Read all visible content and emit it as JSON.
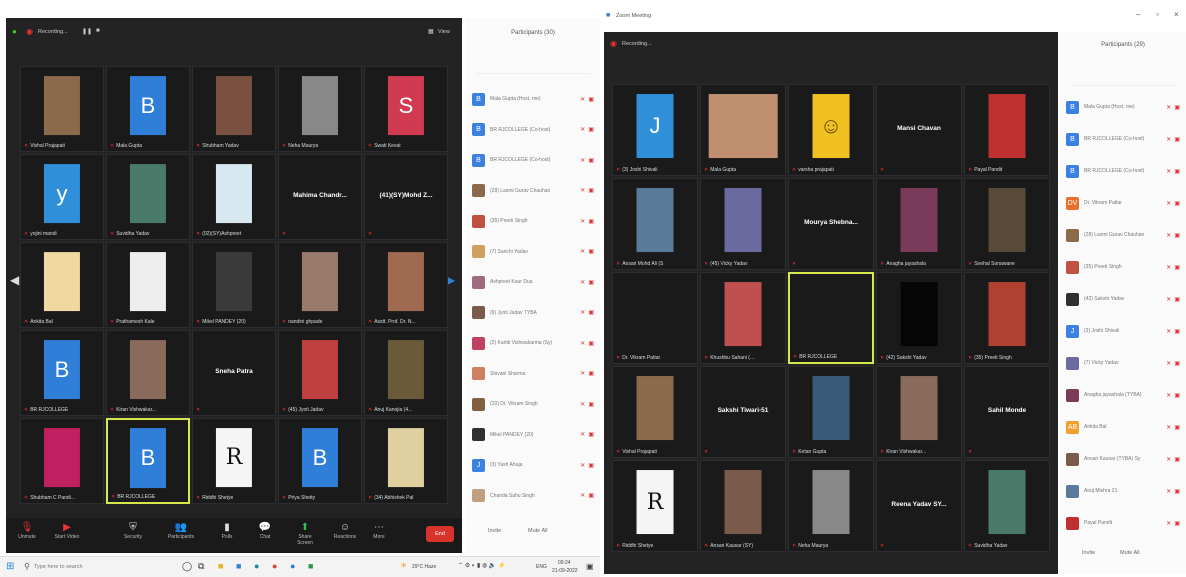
{
  "left": {
    "recording": "Recording...",
    "view": "View",
    "participants_title": "Participants (30)",
    "tiles": [
      {
        "label": "Vishal Prajapati",
        "type": "photo",
        "color": "#8a6a4a"
      },
      {
        "label": "Mala Gupta",
        "type": "letter",
        "letter": "B",
        "color": "#2f7fd8"
      },
      {
        "label": "Shubham Yadav",
        "type": "photo",
        "color": "#7a5040"
      },
      {
        "label": "Neha Maurya",
        "type": "photo",
        "color": "#888"
      },
      {
        "label": "Swati Kevat",
        "type": "letter",
        "letter": "S",
        "color": "#d13b52"
      },
      {
        "label": "yojini mandi",
        "type": "letter",
        "letter": "y",
        "color": "#2f8fd8"
      },
      {
        "label": "Suvidha Yadav",
        "type": "photo",
        "color": "#4a7a6a"
      },
      {
        "label": "(02)(SY)Ashpreet",
        "type": "photo",
        "color": "#d8e8f0"
      },
      {
        "label": "",
        "type": "name",
        "name": "Mahima Chandr..."
      },
      {
        "label": "",
        "type": "name",
        "name": "(41)(SY)Mohd Z..."
      },
      {
        "label": "Ankita Bal",
        "type": "photo",
        "color": "#f0d8a0"
      },
      {
        "label": "Prathamesh Kale",
        "type": "photo",
        "color": "#eeeeee"
      },
      {
        "label": "Mikel PANDEY (20)",
        "type": "photo",
        "color": "#3a3a3a"
      },
      {
        "label": "nandini ghpade",
        "type": "photo",
        "color": "#9a7a6a"
      },
      {
        "label": "Asstt. Prof. Dr. N...",
        "type": "photo",
        "color": "#a06a50"
      },
      {
        "label": "BR RJCOLLEGE",
        "type": "letter",
        "letter": "B",
        "color": "#2f7fd8"
      },
      {
        "label": "Kiran Vishwakar...",
        "type": "photo",
        "color": "#8a6a5a"
      },
      {
        "label": "",
        "type": "name",
        "name": "Sneha Patra"
      },
      {
        "label": "(45) Jyoti Jadav",
        "type": "photo",
        "color": "#c04040"
      },
      {
        "label": "Anuj Kanojia (4...",
        "type": "photo",
        "color": "#6a5a3a"
      },
      {
        "label": "Shubham C Pandi...",
        "type": "photo",
        "color": "#c02060"
      },
      {
        "label": "BR RJCOLLEGE",
        "type": "letter",
        "letter": "B",
        "color": "#2f7fd8",
        "active": true
      },
      {
        "label": "Riddhi Shetye",
        "type": "photo",
        "color": "#f5f5f5",
        "letter": "R"
      },
      {
        "label": "Priya Shetty",
        "type": "letter",
        "letter": "B",
        "color": "#2f7fd8"
      },
      {
        "label": "(34) Abhishek Pal",
        "type": "photo",
        "color": "#e0d0a0"
      }
    ],
    "participants": [
      {
        "name": "Mala Gupta (Host, me)",
        "color": "#3b82e0",
        "letter": "B"
      },
      {
        "name": "BR RJCOLLEGE (Co-host)",
        "color": "#3b82e0",
        "letter": "B"
      },
      {
        "name": "BR RJCOLLEGE (Co-host)",
        "color": "#3b82e0",
        "letter": "B"
      },
      {
        "name": "(28) Laxmi Gurav Chauhan",
        "color": "#8a6a4a",
        "letter": ""
      },
      {
        "name": "(35) Preeti Singh",
        "color": "#c05040",
        "letter": ""
      },
      {
        "name": "(7) Sanchi Yadav",
        "color": "#d0a060",
        "letter": ""
      },
      {
        "name": "Ashpreet Kaur Dua",
        "color": "#a06a80",
        "letter": ""
      },
      {
        "name": "(6) Jyoti Jadav TYBA",
        "color": "#7a5a4a",
        "letter": ""
      },
      {
        "name": "(2) Kartik Vishwakarma (Sy)",
        "color": "#c04060",
        "letter": ""
      },
      {
        "name": "Shivani Sharma",
        "color": "#d08060",
        "letter": ""
      },
      {
        "name": "(20) Dr. Vikram Singh",
        "color": "#806040",
        "letter": ""
      },
      {
        "name": "Mikel PANDEY (20)",
        "color": "#303030",
        "letter": ""
      },
      {
        "name": "(3) Yash Ahuja",
        "color": "#3b82e0",
        "letter": "J"
      },
      {
        "name": "Chanda Sahu Singh",
        "color": "#c0a080",
        "letter": ""
      }
    ],
    "invite": "Invite",
    "mute_all": "Mute All",
    "toolbar": [
      "Unmute",
      "Start Video",
      "Security",
      "Participants",
      "Polls",
      "Chat",
      "Share Screen",
      "Reactions",
      "More"
    ],
    "end": "End"
  },
  "right": {
    "window_title": "Zoom Meeting",
    "recording": "Recording...",
    "participants_title": "Participants (29)",
    "tiles": [
      {
        "label": "(3) Joshi Shivali",
        "type": "letter",
        "letter": "J",
        "color": "#2f8fd8"
      },
      {
        "label": "Mala Gupta",
        "type": "photo",
        "color": "#c09070",
        "wide": true
      },
      {
        "label": "varsha prajapati",
        "type": "emoji",
        "color": "#f0c020"
      },
      {
        "label": "",
        "type": "name",
        "name": "Mansi Chavan"
      },
      {
        "label": "Payal Pandit",
        "type": "photo",
        "color": "#c03030"
      },
      {
        "label": "Ansari Mohd Ali (S",
        "type": "photo",
        "color": "#5a7a9a"
      },
      {
        "label": "(45) Vicky Yadav",
        "type": "photo",
        "color": "#6a6aa0"
      },
      {
        "label": "",
        "type": "name",
        "name": "Mourya Shebna..."
      },
      {
        "label": "Anagha jayashala",
        "type": "photo",
        "color": "#7a3a5a"
      },
      {
        "label": "Snehal Sonawane",
        "type": "photo",
        "color": "#5a4a3a"
      },
      {
        "label": "Dr. Vikram Pattar",
        "type": "blank",
        "color": "#1a1a1a"
      },
      {
        "label": "Khushbu Sahani (...",
        "type": "photo",
        "color": "#c05050"
      },
      {
        "label": "BR RJCOLLEGE",
        "type": "blank",
        "color": "#1a1a1a",
        "active": true
      },
      {
        "label": "(42) Sakshi Yadav",
        "type": "photo",
        "color": "#050505"
      },
      {
        "label": "(35) Preeti Singh",
        "type": "photo",
        "color": "#b04030"
      },
      {
        "label": "Vishal Prajapati",
        "type": "photo",
        "color": "#8a6a4a"
      },
      {
        "label": "",
        "type": "name",
        "name": "Sakshi Tiwari-51"
      },
      {
        "label": "Ketan Gupta",
        "type": "photo",
        "color": "#3a5a7a"
      },
      {
        "label": "Kiran Vishwakar...",
        "type": "photo",
        "color": "#8a6a5a"
      },
      {
        "label": "",
        "type": "name",
        "name": "Sahil Monde"
      },
      {
        "label": "Riddhi Shetye",
        "type": "photo",
        "color": "#f5f5f5",
        "letter": "R"
      },
      {
        "label": "Ansari Kausar (SY)",
        "type": "photo",
        "color": "#7a5a4a"
      },
      {
        "label": "Neha Maurya",
        "type": "photo",
        "color": "#888"
      },
      {
        "label": "",
        "type": "name",
        "name": "Reena Yadav SY..."
      },
      {
        "label": "Suvidha Yadav",
        "type": "photo",
        "color": "#4a7a6a"
      }
    ],
    "participants": [
      {
        "name": "Mala Gupta (Host, me)",
        "color": "#3b82e0",
        "letter": "B"
      },
      {
        "name": "BR RJCOLLEGE (Co-host)",
        "color": "#3b82e0",
        "letter": "B"
      },
      {
        "name": "BR RJCOLLEGE (Co-host)",
        "color": "#3b82e0",
        "letter": "B"
      },
      {
        "name": "Dr. Vikram Pattar",
        "color": "#e8702a",
        "letter": "DV"
      },
      {
        "name": "(28) Laxmi Gurav Chauhan",
        "color": "#8a6a4a",
        "letter": ""
      },
      {
        "name": "(35) Preeti Singh",
        "color": "#c05040",
        "letter": ""
      },
      {
        "name": "(42) Sakshi Yadav",
        "color": "#303030",
        "letter": ""
      },
      {
        "name": "(3) Joshi Shivali",
        "color": "#3b82e0",
        "letter": "J"
      },
      {
        "name": "(7) Vicky Yadav",
        "color": "#6a6aa0",
        "letter": ""
      },
      {
        "name": "Anagha jayashala (TYBA)",
        "color": "#7a3a5a",
        "letter": ""
      },
      {
        "name": "Ankita Bal",
        "color": "#f0a030",
        "letter": "AB"
      },
      {
        "name": "Ansari Kausar (TYBA) Sy",
        "color": "#7a5a4a",
        "letter": ""
      },
      {
        "name": "Anuj Mishra 21",
        "color": "#5a7a9a",
        "letter": ""
      },
      {
        "name": "Payal Pandit",
        "color": "#c03030",
        "letter": ""
      }
    ],
    "invite": "Invite",
    "mute_all": "Mute All"
  },
  "taskbar": {
    "search_placeholder": "Type here to search",
    "weather": "29°C Haze",
    "lang": "ENG",
    "time": "09:24",
    "date": "21-09-2022"
  }
}
